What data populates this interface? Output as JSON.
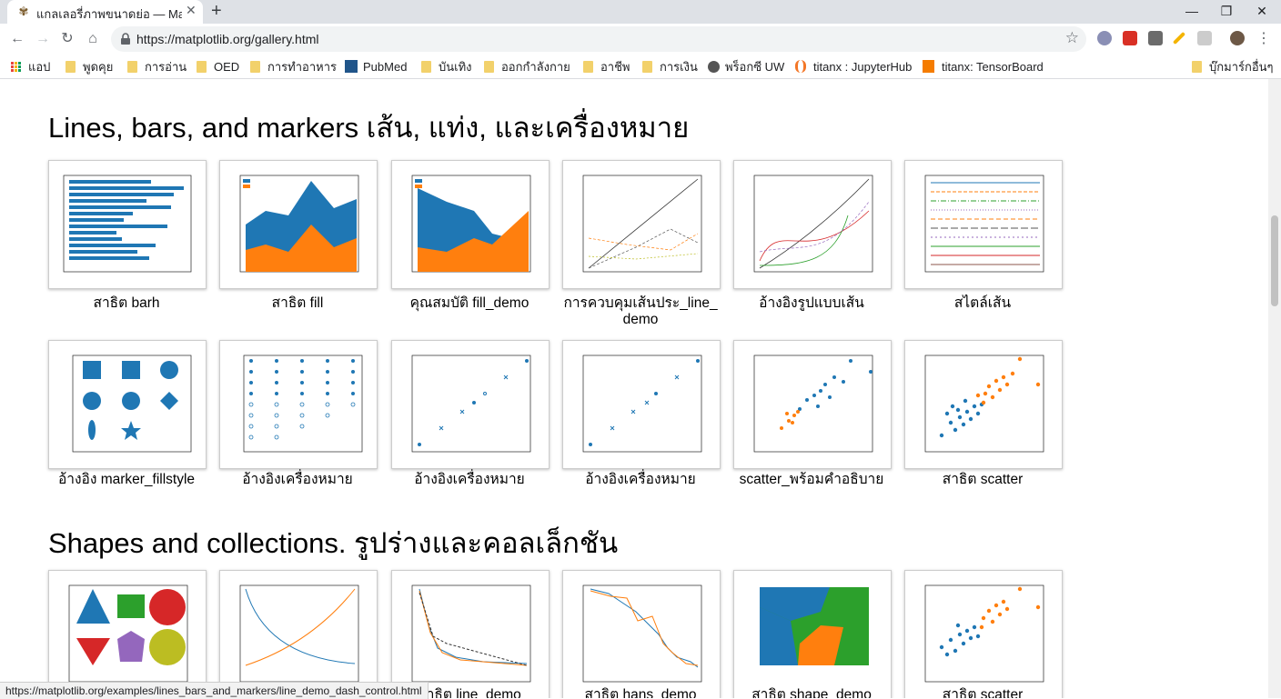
{
  "browser": {
    "tab_title": "แกลเลอรี่ภาพขนาดย่อ — Mat",
    "url": "https://matplotlib.org/gallery.html"
  },
  "bookmarks": {
    "apps": "แอป",
    "items": [
      "พูดคุย",
      "การอ่าน",
      "OED",
      "การทำอาหาร",
      "PubMed",
      "บันเทิง",
      "ออกกำลังกาย",
      "อาชีพ",
      "การเงิน",
      "พร็อกซี UW",
      "titanx : JupyterHub",
      "titanx: TensorBoard"
    ],
    "other": "บุ๊กมาร์กอื่นๆ"
  },
  "sections": {
    "lines_heading": "Lines, bars, and markers เส้น, แท่ง, และเครื่องหมาย",
    "shapes_heading": "Shapes and collections. รูปร่างและคอลเล็กชัน"
  },
  "gallery_row1": [
    "สาธิต barh",
    "สาธิต fill",
    "คุณสมบัติ fill_demo",
    "การควบคุมเส้นประ_line_ demo",
    "อ้างอิงรูปแบบเส้น",
    "สไตล์เส้น"
  ],
  "gallery_row2": [
    "อ้างอิง marker_fillstyle",
    "อ้างอิงเครื่องหมาย",
    "อ้างอิงเครื่องหมาย",
    "อ้างอิงเครื่องหมาย",
    "scatter_พร้อมคำอธิบาย",
    "สาธิต scatter"
  ],
  "gallery_row3": [
    "สาธิต line_demo",
    "สาธิต hans_demo",
    "สาธิต shape_demo",
    "สาธิต scatter"
  ],
  "status_url": "https://matplotlib.org/examples/lines_bars_and_markers/line_demo_dash_control.html",
  "colors": {
    "blue": "#1f77b4",
    "orange": "#ff7f0e",
    "green": "#2ca02c",
    "red": "#d62728",
    "purple": "#9467bd",
    "olive": "#bcbd22"
  }
}
